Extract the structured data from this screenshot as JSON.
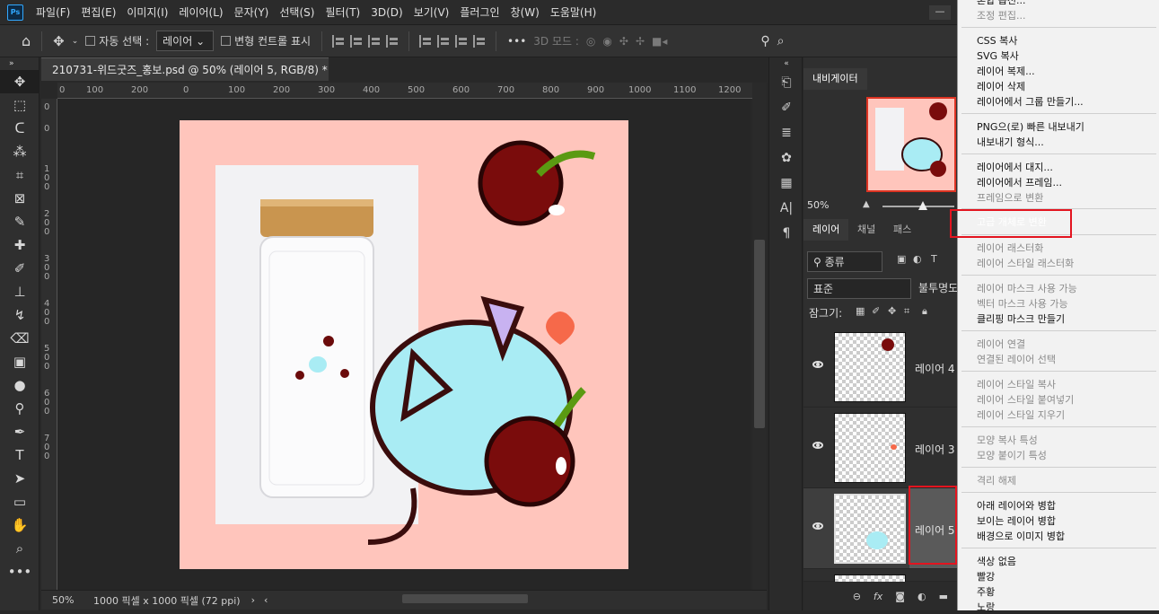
{
  "app": {
    "logo": "Ps",
    "minimize": "—"
  },
  "menubar": {
    "items": [
      "파일(F)",
      "편집(E)",
      "이미지(I)",
      "레이어(L)",
      "문자(Y)",
      "선택(S)",
      "필터(T)",
      "3D(D)",
      "보기(V)",
      "플러그인",
      "창(W)",
      "도움말(H)"
    ]
  },
  "options": {
    "auto_select": "자동 선택 :",
    "target": "레이어",
    "transform_controls": "변형 컨트롤 표시",
    "more": "•••",
    "mode3d": "3D 모드 :"
  },
  "document": {
    "tab_title": "210731-위드굿즈_홍보.psd @ 50% (레이어 5, RGB/8) *",
    "close": "×",
    "zoom": "50%",
    "size_info": "1000 픽셀 x 1000 픽셀 (72 ppi)",
    "ruler_top": [
      "0",
      "100",
      "200",
      "0",
      "100",
      "200",
      "300",
      "400",
      "500",
      "600",
      "700",
      "800",
      "900",
      "1000",
      "1100",
      "1200"
    ],
    "ruler_left": [
      "0",
      "0",
      "1 0 0",
      "2 0 0",
      "3 0 0",
      "4 0 0",
      "5 0 0",
      "6 0 0",
      "7 0 0"
    ]
  },
  "navigator": {
    "tab": "내비게이터",
    "zoom": "50%"
  },
  "layers_panel": {
    "tabs": [
      "레이어",
      "채널",
      "패스"
    ],
    "kind_filter": "종류",
    "blend_mode": "표준",
    "opacity_label": "불투명도",
    "lock_label": "잠그기:",
    "layers": [
      {
        "name": "레이어 4",
        "visible": true,
        "selected": false
      },
      {
        "name": "레이어 3",
        "visible": true,
        "selected": false
      },
      {
        "name": "레이어 5",
        "visible": true,
        "selected": true
      }
    ]
  },
  "context_menu": {
    "items": [
      {
        "label": "혼합 옵션...",
        "disabled": false
      },
      {
        "label": "조정 편집...",
        "disabled": true
      },
      {
        "sep": true
      },
      {
        "label": "CSS 복사",
        "disabled": false
      },
      {
        "label": "SVG 복사",
        "disabled": false
      },
      {
        "label": "레이어 복제...",
        "disabled": false
      },
      {
        "label": "레이어 삭제",
        "disabled": false
      },
      {
        "label": "레이어에서 그룹 만들기...",
        "disabled": false
      },
      {
        "sep": true
      },
      {
        "label": "PNG으(로) 빠른 내보내기",
        "disabled": false
      },
      {
        "label": "내보내기 형식...",
        "disabled": false
      },
      {
        "sep": true
      },
      {
        "label": "레이어에서 대지...",
        "disabled": false
      },
      {
        "label": "레이어에서 프레임...",
        "disabled": false
      },
      {
        "label": "프레임으로 변환",
        "disabled": true
      },
      {
        "sep": true
      },
      {
        "label": "고급 개체로 변환",
        "disabled": false,
        "highlighted": true
      },
      {
        "sep": true
      },
      {
        "label": "레이어 래스터화",
        "disabled": true
      },
      {
        "label": "레이어 스타일 래스터화",
        "disabled": true
      },
      {
        "sep": true
      },
      {
        "label": "레이어 마스크 사용 가능",
        "disabled": true
      },
      {
        "label": "벡터 마스크 사용 가능",
        "disabled": true
      },
      {
        "label": "클리핑 마스크 만들기",
        "disabled": false
      },
      {
        "sep": true
      },
      {
        "label": "레이어 연결",
        "disabled": true
      },
      {
        "label": "연결된 레이어 선택",
        "disabled": true
      },
      {
        "sep": true
      },
      {
        "label": "레이어 스타일 복사",
        "disabled": true
      },
      {
        "label": "레이어 스타일 붙여넣기",
        "disabled": true
      },
      {
        "label": "레이어 스타일 지우기",
        "disabled": true
      },
      {
        "sep": true
      },
      {
        "label": "모양 복사 특성",
        "disabled": true
      },
      {
        "label": "모양 붙이기 특성",
        "disabled": true
      },
      {
        "sep": true
      },
      {
        "label": "격리 해제",
        "disabled": true
      },
      {
        "sep": true
      },
      {
        "label": "아래 레이어와 병합",
        "disabled": false
      },
      {
        "label": "보이는 레이어 병합",
        "disabled": false
      },
      {
        "label": "배경으로 이미지 병합",
        "disabled": false
      },
      {
        "sep": true
      },
      {
        "label": "색상 없음",
        "disabled": false
      },
      {
        "label": "빨강",
        "disabled": false
      },
      {
        "label": "주황",
        "disabled": false
      },
      {
        "label": "노랑",
        "disabled": false
      }
    ]
  },
  "colors": {
    "accent": "#0078d7",
    "highlight_box": "#e3141f",
    "canvas_bg": "#ffc5bc"
  }
}
